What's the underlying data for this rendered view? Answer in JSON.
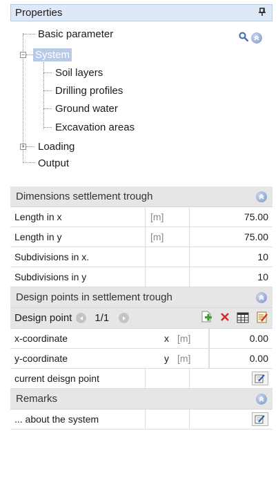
{
  "panel": {
    "title": "Properties",
    "pin_glyph": "ф"
  },
  "tree": {
    "items": [
      {
        "label": "Basic parameter"
      },
      {
        "label": "System"
      },
      {
        "label": "Soil layers"
      },
      {
        "label": "Drilling profiles"
      },
      {
        "label": "Ground water"
      },
      {
        "label": "Excavation areas"
      },
      {
        "label": "Loading"
      },
      {
        "label": "Output"
      }
    ],
    "expander_minus": "−",
    "expander_plus": "+",
    "tool_icons": [
      "search-icon",
      "collapse-up-icon"
    ]
  },
  "sections": {
    "dimensions": {
      "title": "Dimensions settlement trough",
      "rows": [
        {
          "label": "Length in x",
          "unit": "[m]",
          "value": "75.00"
        },
        {
          "label": "Length in y",
          "unit": "[m]",
          "value": "75.00"
        },
        {
          "label": "Subdivisions in x.",
          "unit": "",
          "value": "10"
        },
        {
          "label": "Subdivisions in y",
          "unit": "",
          "value": "10"
        }
      ]
    },
    "design_points": {
      "title": "Design points in settlement trough",
      "toolbar": {
        "label": "Design point",
        "counter": "1/1"
      },
      "rows": [
        {
          "label": "x-coordinate",
          "symbol": "x",
          "unit": "[m]",
          "value": "0.00"
        },
        {
          "label": "y-coordinate",
          "symbol": "y",
          "unit": "[m]",
          "value": "0.00"
        }
      ],
      "current_label": "current deisgn point"
    },
    "remarks": {
      "title": "Remarks",
      "row_label": "... about the system"
    }
  },
  "colors": {
    "accent": "#7d94c6",
    "selection": "#b9c9e8",
    "header_bg": "#dfe8f6",
    "section_bg": "#e6e6e6",
    "add_green": "#3aa02e",
    "delete_red": "#d62a2a"
  }
}
